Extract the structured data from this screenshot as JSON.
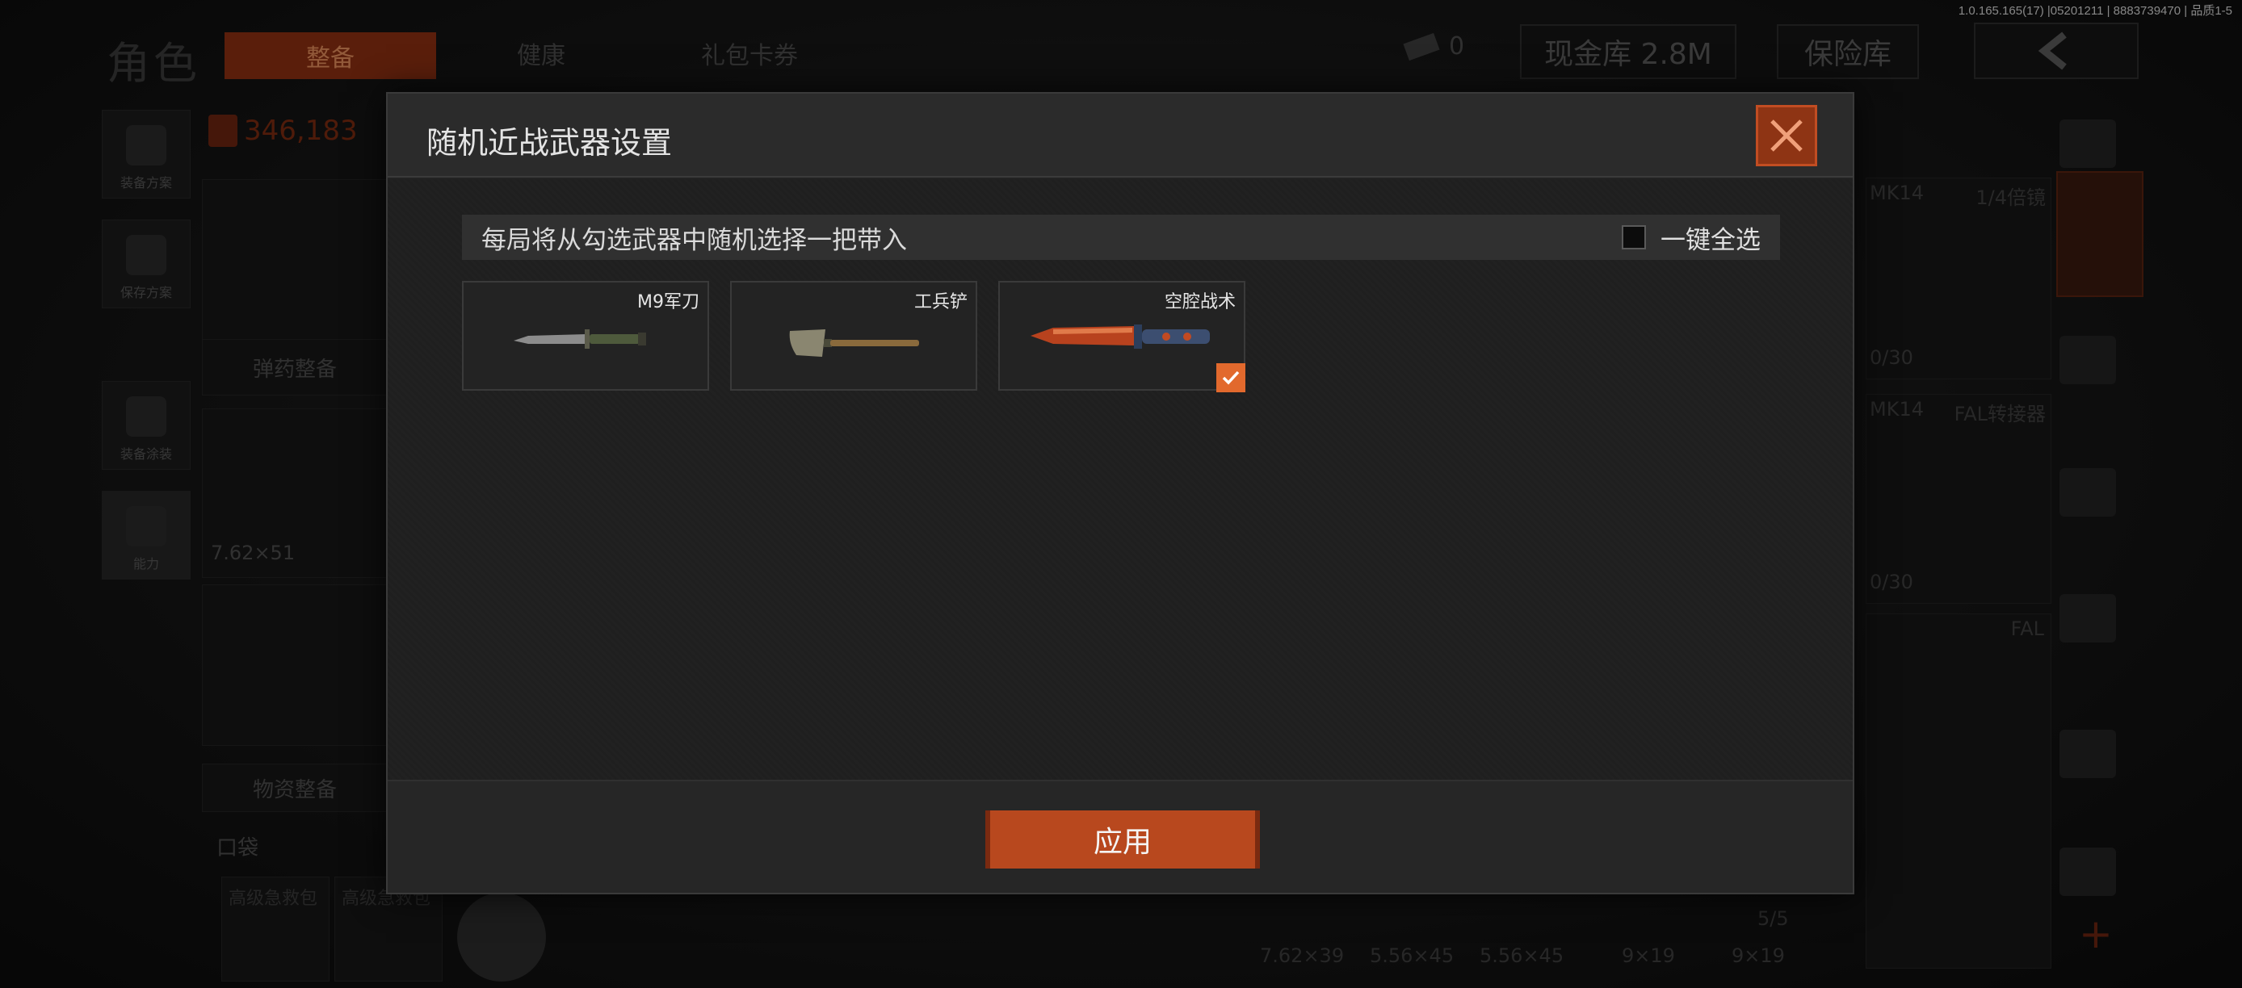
{
  "version": "1.0.165.165(17) |05201211 | 8883739470 | 品质1-5",
  "background": {
    "title": "角色",
    "tabs": [
      "整备",
      "健康",
      "礼包卡券"
    ],
    "currency_count": "0",
    "cash_vault_label": "现金库 2.8M",
    "safe_label": "保险库",
    "value_display": "346,183",
    "sidebar_items": [
      "装备方案",
      "保存方案",
      "装备涂装",
      "能力"
    ],
    "ammo_supply_label": "弹药整备",
    "material_supply_label": "物资整备",
    "pocket_label": "口袋",
    "caliber": "7.62×51",
    "pocket_items": [
      "高级急救包",
      "高级急救包"
    ],
    "right_slots": [
      "MK14",
      "1/4倍镜",
      "0/30",
      "MK14",
      "FAL转接器",
      "0/30",
      "FAL",
      "5/5"
    ],
    "ammo_types": [
      "7.62×39",
      "5.56×45",
      "5.56×45",
      "9×19",
      "9×19"
    ]
  },
  "modal": {
    "title": "随机近战武器设置",
    "info_text": "每局将从勾选武器中随机选择一把带入",
    "select_all_label": "一键全选",
    "weapons": [
      {
        "name": "M9军刀",
        "checked": false
      },
      {
        "name": "工兵铲",
        "checked": false
      },
      {
        "name": "空腔战术",
        "checked": true
      }
    ],
    "apply_label": "应用"
  },
  "colors": {
    "accent": "#b8481e",
    "check": "#e2692d"
  }
}
